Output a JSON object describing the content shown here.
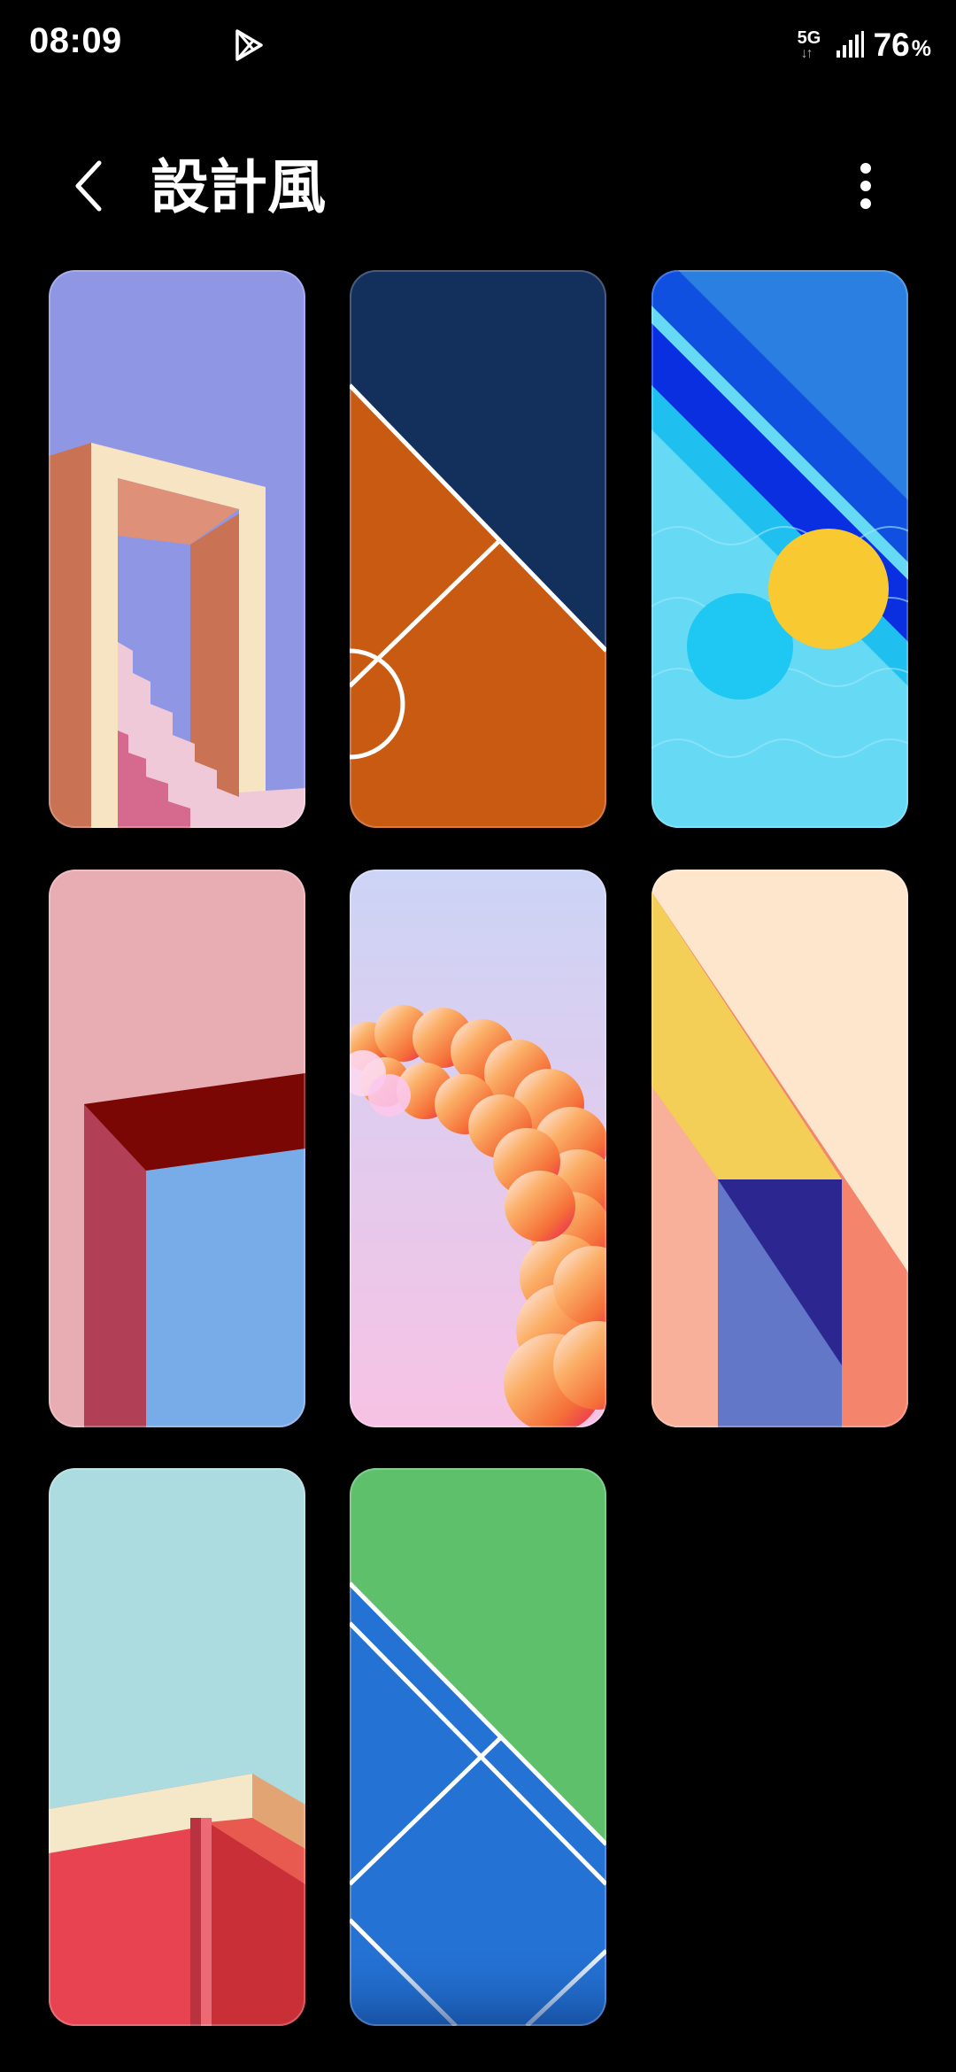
{
  "status_bar": {
    "time": "08:09",
    "network": "5G",
    "battery": "76",
    "battery_unit": "%",
    "icons": [
      "play-store-icon",
      "signal-icon"
    ]
  },
  "header": {
    "title": "設計風",
    "back_icon": "chevron-left-icon",
    "more_icon": "more-vert-icon"
  },
  "wallpapers": [
    {
      "name": "wallpaper-arch-stairs"
    },
    {
      "name": "wallpaper-basketball-court"
    },
    {
      "name": "wallpaper-pool-sun"
    },
    {
      "name": "wallpaper-red-doorway"
    },
    {
      "name": "wallpaper-clouds"
    },
    {
      "name": "wallpaper-geometric-triangles"
    },
    {
      "name": "wallpaper-red-building"
    },
    {
      "name": "wallpaper-tennis-court"
    }
  ],
  "colors": {
    "background": "#000000",
    "text": "#ffffff"
  }
}
